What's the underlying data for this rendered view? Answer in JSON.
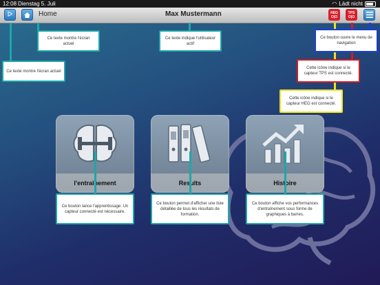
{
  "status_bar": {
    "time": "12:08",
    "date": "Dienstag 5. Juli",
    "charging": "Lädt nicht"
  },
  "nav": {
    "title": "Home",
    "user": "Max Mustermann",
    "sensor_heg": [
      "HEG",
      "O|O"
    ],
    "sensor_tps": [
      "TPS",
      "O|O"
    ]
  },
  "tiles": [
    {
      "label": "l'entraînement",
      "icon": "brain-dumbbell-icon"
    },
    {
      "label": "Results",
      "icon": "binders-icon"
    },
    {
      "label": "Histoire",
      "icon": "chart-up-icon"
    }
  ],
  "callouts": {
    "screen_left": "Ce texte montre l'écran actuel",
    "screen_top": "Ce texte montre l'écran actuel",
    "user": "Ce texte indique l'utilisateur actif",
    "menu": "Ce bouton ouvre le menu de navigation",
    "tps": "Cette icône indique si le capteur TPS est connecté.",
    "heg": "Cette icône indique si le capteur HEG est connecté.",
    "training": "Ce bouton lance l'apprentissage. Un capteur connecté est nécessaire.",
    "results": "Ce bouton permet d'afficher une liste détaillée de tous les résultats de formation.",
    "history": "Ce bouton affiche vos performances d'entraînement sous forme de graphiques à barres."
  },
  "colors": {
    "accent_teal": "#1fa7a8",
    "sensor_red": "#d91f2a",
    "heg_line": "#f1e21a",
    "menu_line": "#1a3fd6"
  }
}
